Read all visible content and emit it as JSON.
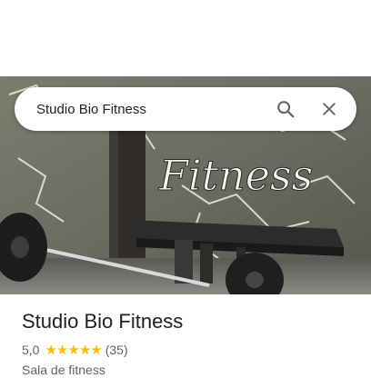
{
  "search": {
    "query": "Studio Bio Fitness"
  },
  "hero": {
    "wall_graffiti_text": "Fitness"
  },
  "place": {
    "name": "Studio Bio Fitness",
    "rating": "5,0",
    "stars": 5,
    "review_count": "(35)",
    "category": "Sala de fitness"
  },
  "colors": {
    "star": "#fbbc04",
    "title_text": "#202124",
    "secondary_text": "#5f6368"
  },
  "icons": [
    "search-icon",
    "close-icon",
    "star-icon"
  ]
}
